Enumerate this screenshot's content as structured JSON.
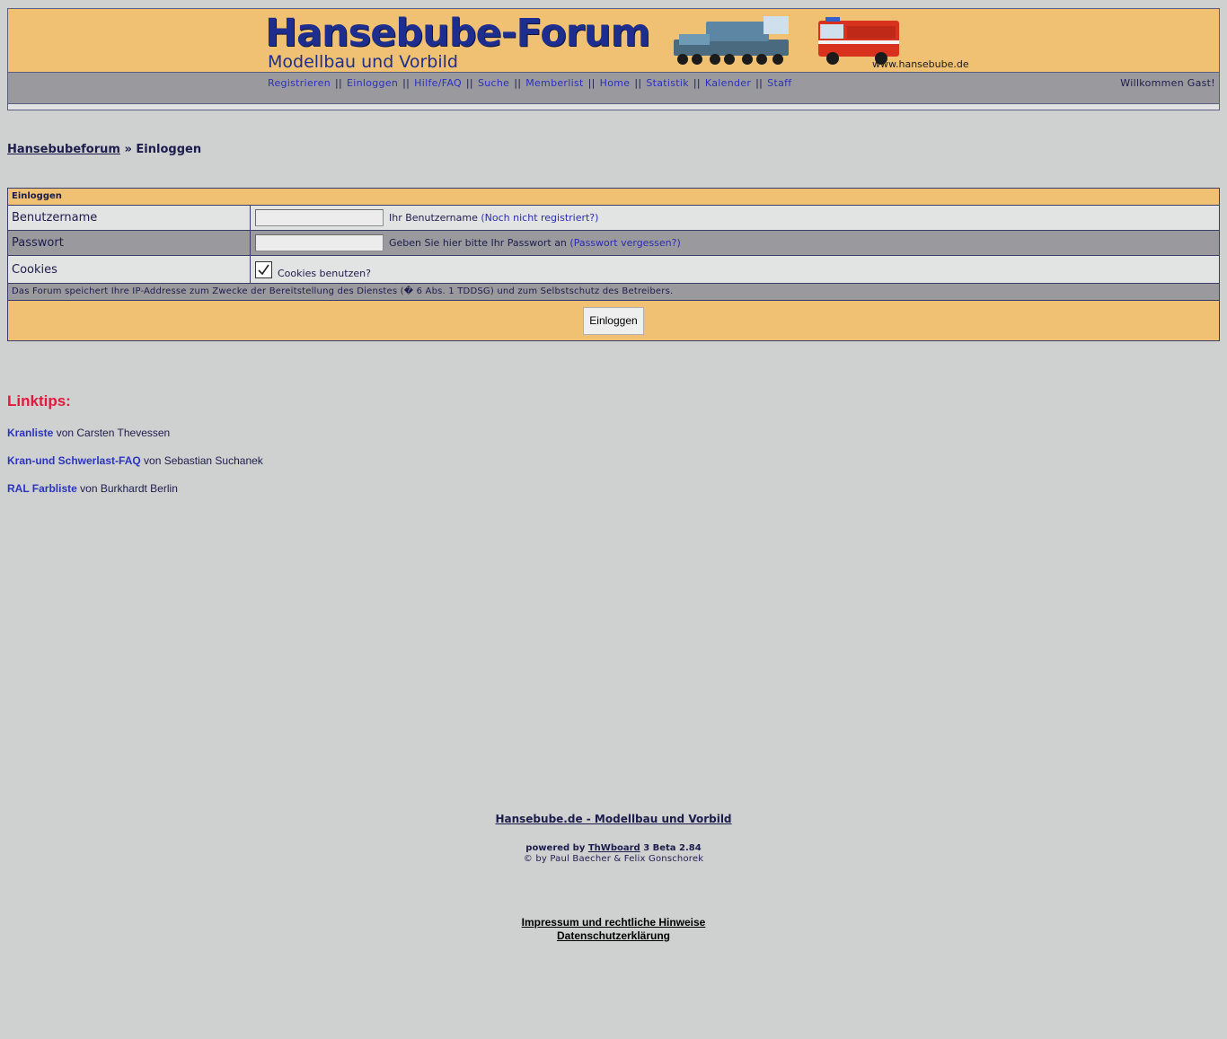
{
  "header": {
    "logo_title": "Hansebube-Forum",
    "logo_subtitle": "Modellbau und Vorbild",
    "logo_url": "www.hansebube.de",
    "nav": [
      {
        "label": "Registrieren"
      },
      {
        "label": "Einloggen"
      },
      {
        "label": "Hilfe/FAQ"
      },
      {
        "label": "Suche"
      },
      {
        "label": "Memberlist"
      },
      {
        "label": "Home"
      },
      {
        "label": "Statistik"
      },
      {
        "label": "Kalender"
      },
      {
        "label": "Staff"
      }
    ],
    "nav_separator": "||",
    "welcome": "Willkommen Gast!"
  },
  "breadcrumb": {
    "home": "Hansebubeforum",
    "separator": "»",
    "current": "Einloggen"
  },
  "login": {
    "title": "Einloggen",
    "username_label": "Benutzername",
    "username_value": "",
    "username_hint": "Ihr Benutzername",
    "register_link": "(Noch nicht registriert?)",
    "password_label": "Passwort",
    "password_value": "",
    "password_hint": "Geben Sie hier bitte Ihr Passwort an",
    "forgot_link": "(Passwort vergessen?)",
    "cookies_label": "Cookies",
    "cookies_checked": true,
    "cookies_text": "Cookies benutzen?",
    "ip_notice": "Das Forum speichert Ihre IP-Addresse zum Zwecke der Bereitstellung des Dienstes (� 6 Abs. 1 TDDSG) und zum Selbstschutz des Betreibers.",
    "submit_label": "Einloggen"
  },
  "linktips": {
    "title": "Linktips:",
    "items": [
      {
        "link": "Kranliste",
        "text": "von Carsten Thevessen"
      },
      {
        "link": "Kran-und Schwerlast-FAQ",
        "text": "von Sebastian Suchanek"
      },
      {
        "link": "RAL Farbliste",
        "text": "von Burkhardt Berlin"
      }
    ]
  },
  "footer": {
    "site_title": "Hansebube.de - Modellbau und Vorbild",
    "powered_prefix": "powered by",
    "board_name": "ThWboard",
    "board_version": "3 Beta 2.84",
    "copyright": "© by Paul Baecher & Felix Gonschorek",
    "impressum": "Impressum und rechtliche Hinweise",
    "privacy": "Datenschutzerklärung"
  },
  "colors": {
    "background": "#cfd1d0",
    "header_orange": "#f0c173",
    "nav_gray": "#9a9a9e",
    "linktips_red": "#e11a3c",
    "link_blue": "#2a2fc0"
  }
}
